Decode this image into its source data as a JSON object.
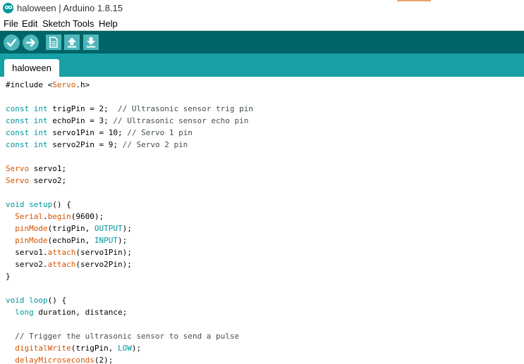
{
  "window": {
    "title": "haloween | Arduino 1.8.15",
    "icon": "arduino-infinity-icon",
    "icon_glyph": "oo"
  },
  "menu": [
    "File",
    "Edit",
    "Sketch",
    "Tools",
    "Help"
  ],
  "toolbar": {
    "buttons": [
      {
        "name": "verify-button",
        "icon": "checkmark-icon"
      },
      {
        "name": "upload-button",
        "icon": "arrow-right-icon"
      },
      {
        "name": "new-button",
        "icon": "new-file-icon"
      },
      {
        "name": "open-button",
        "icon": "arrow-up-icon"
      },
      {
        "name": "save-button",
        "icon": "arrow-down-icon"
      }
    ]
  },
  "tabs": [
    {
      "label": "haloween",
      "active": true
    }
  ],
  "colors": {
    "toolbar": "#006468",
    "tabbar": "#17a1a5",
    "button": "#4db7bb",
    "keyword": "#00979c",
    "class": "#d35400",
    "comment": "#434f54"
  },
  "code": [
    [
      {
        "t": "#include <",
        "c": ""
      },
      {
        "t": "Servo",
        "c": "cls"
      },
      {
        "t": ".h>",
        "c": ""
      }
    ],
    [],
    [
      {
        "t": "const",
        "c": "kw"
      },
      {
        "t": " ",
        "c": ""
      },
      {
        "t": "int",
        "c": "kw"
      },
      {
        "t": " trigPin = 2;  ",
        "c": ""
      },
      {
        "t": "// Ultrasonic sensor trig pin",
        "c": "cmt"
      }
    ],
    [
      {
        "t": "const",
        "c": "kw"
      },
      {
        "t": " ",
        "c": ""
      },
      {
        "t": "int",
        "c": "kw"
      },
      {
        "t": " echoPin = 3; ",
        "c": ""
      },
      {
        "t": "// Ultrasonic sensor echo pin",
        "c": "cmt"
      }
    ],
    [
      {
        "t": "const",
        "c": "kw"
      },
      {
        "t": " ",
        "c": ""
      },
      {
        "t": "int",
        "c": "kw"
      },
      {
        "t": " servo1Pin = 10; ",
        "c": ""
      },
      {
        "t": "// Servo 1 pin",
        "c": "cmt"
      }
    ],
    [
      {
        "t": "const",
        "c": "kw"
      },
      {
        "t": " ",
        "c": ""
      },
      {
        "t": "int",
        "c": "kw"
      },
      {
        "t": " servo2Pin = 9; ",
        "c": ""
      },
      {
        "t": "// Servo 2 pin",
        "c": "cmt"
      }
    ],
    [],
    [
      {
        "t": "Servo",
        "c": "cls"
      },
      {
        "t": " servo1;",
        "c": ""
      }
    ],
    [
      {
        "t": "Servo",
        "c": "cls"
      },
      {
        "t": " servo2;",
        "c": ""
      }
    ],
    [],
    [
      {
        "t": "void",
        "c": "kw"
      },
      {
        "t": " ",
        "c": ""
      },
      {
        "t": "setup",
        "c": "kw"
      },
      {
        "t": "() {",
        "c": ""
      }
    ],
    [
      {
        "t": "  ",
        "c": ""
      },
      {
        "t": "Serial",
        "c": "cls"
      },
      {
        "t": ".",
        "c": ""
      },
      {
        "t": "begin",
        "c": "cls"
      },
      {
        "t": "(9600);",
        "c": ""
      }
    ],
    [
      {
        "t": "  ",
        "c": ""
      },
      {
        "t": "pinMode",
        "c": "cls"
      },
      {
        "t": "(trigPin, ",
        "c": ""
      },
      {
        "t": "OUTPUT",
        "c": "kw"
      },
      {
        "t": ");",
        "c": ""
      }
    ],
    [
      {
        "t": "  ",
        "c": ""
      },
      {
        "t": "pinMode",
        "c": "cls"
      },
      {
        "t": "(echoPin, ",
        "c": ""
      },
      {
        "t": "INPUT",
        "c": "kw"
      },
      {
        "t": ");",
        "c": ""
      }
    ],
    [
      {
        "t": "  servo1.",
        "c": ""
      },
      {
        "t": "attach",
        "c": "cls"
      },
      {
        "t": "(servo1Pin);",
        "c": ""
      }
    ],
    [
      {
        "t": "  servo2.",
        "c": ""
      },
      {
        "t": "attach",
        "c": "cls"
      },
      {
        "t": "(servo2Pin);",
        "c": ""
      }
    ],
    [
      {
        "t": "}",
        "c": ""
      }
    ],
    [],
    [
      {
        "t": "void",
        "c": "kw"
      },
      {
        "t": " ",
        "c": ""
      },
      {
        "t": "loop",
        "c": "kw"
      },
      {
        "t": "() {",
        "c": ""
      }
    ],
    [
      {
        "t": "  ",
        "c": ""
      },
      {
        "t": "long",
        "c": "kw"
      },
      {
        "t": " duration, distance;",
        "c": ""
      }
    ],
    [],
    [
      {
        "t": "  ",
        "c": ""
      },
      {
        "t": "// Trigger the ultrasonic sensor to send a pulse",
        "c": "cmt"
      }
    ],
    [
      {
        "t": "  ",
        "c": ""
      },
      {
        "t": "digitalWrite",
        "c": "cls"
      },
      {
        "t": "(trigPin, ",
        "c": ""
      },
      {
        "t": "LOW",
        "c": "kw"
      },
      {
        "t": ");",
        "c": ""
      }
    ],
    [
      {
        "t": "  ",
        "c": ""
      },
      {
        "t": "delayMicroseconds",
        "c": "cls"
      },
      {
        "t": "(2);",
        "c": ""
      }
    ]
  ]
}
